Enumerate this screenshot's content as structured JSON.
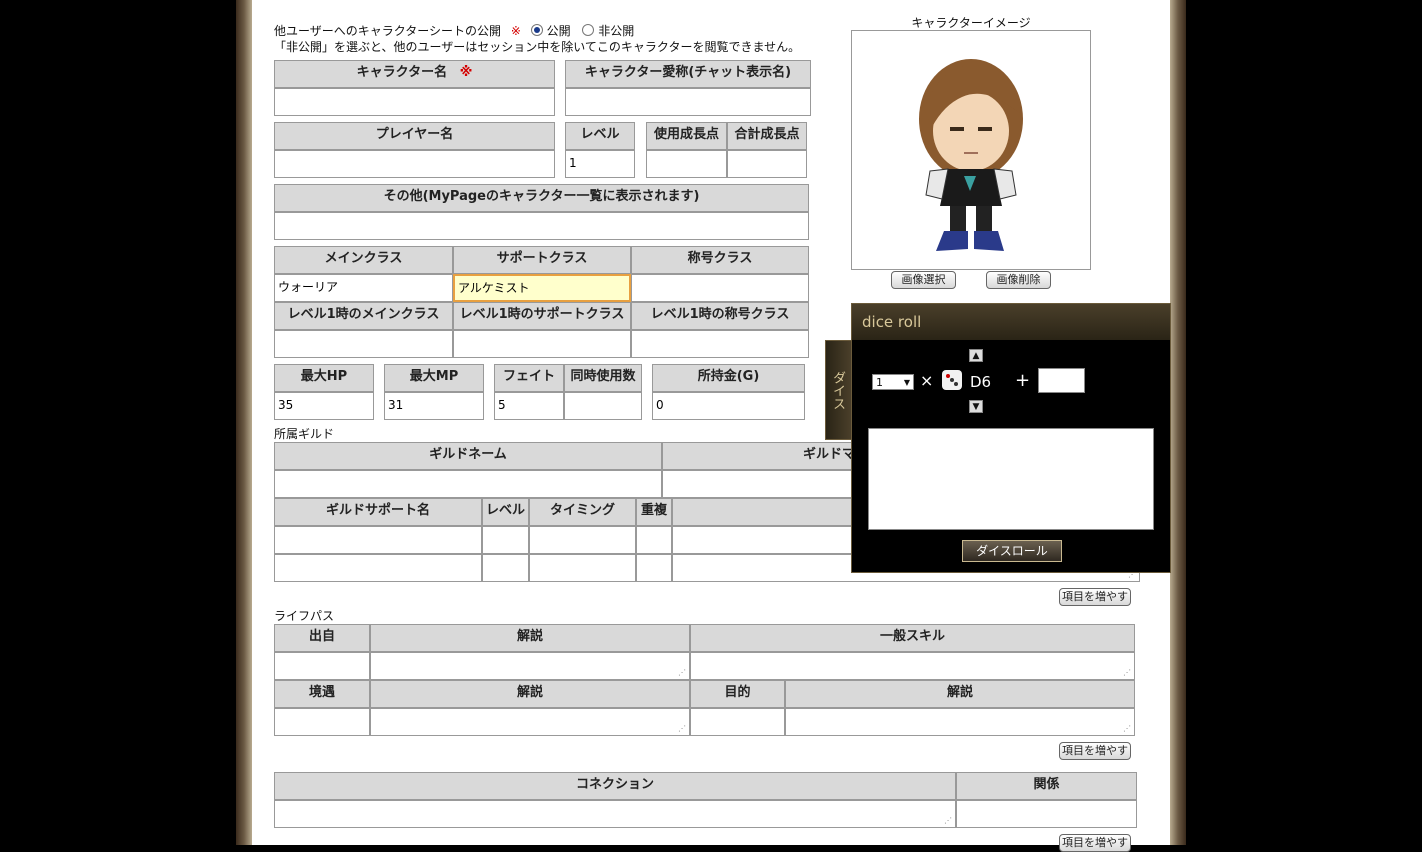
{
  "visibility": {
    "label": "他ユーザーへのキャラクターシートの公開",
    "required_mark": "※",
    "public_label": "公開",
    "private_label": "非公開",
    "selected": "公開",
    "note": "「非公開」を選ぶと、他のユーザーはセッション中を除いてこのキャラクターを閲覧できません。"
  },
  "fields": {
    "char_name": {
      "label": "キャラクター名",
      "value": ""
    },
    "char_nick": {
      "label": "キャラクター愛称(チャット表示名)",
      "value": ""
    },
    "player_name": {
      "label": "プレイヤー名",
      "value": ""
    },
    "level": {
      "label": "レベル",
      "value": "1"
    },
    "used_growth": {
      "label": "使用成長点",
      "value": ""
    },
    "total_growth": {
      "label": "合計成長点",
      "value": ""
    },
    "other": {
      "label": "その他(MyPageのキャラクター一覧に表示されます)",
      "value": ""
    }
  },
  "classes": {
    "main_label": "メインクラス",
    "main_value": "ウォーリア",
    "support_label": "サポートクラス",
    "support_value": "アルケミスト",
    "title_label": "称号クラス",
    "title_value": "",
    "lv1_main_label": "レベル1時のメインクラス",
    "lv1_support_label": "レベル1時のサポートクラス",
    "lv1_title_label": "レベル1時の称号クラス"
  },
  "stats": {
    "hp_label": "最大HP",
    "hp_value": "35",
    "mp_label": "最大MP",
    "mp_value": "31",
    "fate_label": "フェイト",
    "fate_value": "5",
    "simul_label": "同時使用数",
    "simul_value": "",
    "gold_label": "所持金(G)",
    "gold_value": "0"
  },
  "guild": {
    "section_label": "所属ギルド",
    "name_label": "ギルドネーム",
    "master_label": "ギルドマ",
    "support_cols": [
      "ギルドサポート名",
      "レベル",
      "タイミング",
      "重複"
    ],
    "add_button": "項目を増やす"
  },
  "lifepath": {
    "section_label": "ライフパス",
    "origin_label": "出自",
    "desc_label": "解説",
    "skill_label": "一般スキル",
    "circumstance_label": "境遇",
    "goal_label": "目的",
    "add_button": "項目を増やす"
  },
  "connection": {
    "label": "コネクション",
    "relation_label": "関係",
    "add_button": "項目を増やす"
  },
  "image": {
    "title": "キャラクターイメージ",
    "select_button": "画像選択",
    "delete_button": "画像削除"
  },
  "dice": {
    "title": "dice roll",
    "tab_label": "ダイス",
    "count_value": "1",
    "times_sign": "×",
    "die_type": "D6",
    "plus_sign": "+",
    "modifier_value": "",
    "roll_button": "ダイスロール"
  },
  "colors": {
    "required": "#d40000",
    "header_bg": "#d9d9d9",
    "highlight_input": "#ffffcc",
    "dice_text": "#d8c89a"
  }
}
